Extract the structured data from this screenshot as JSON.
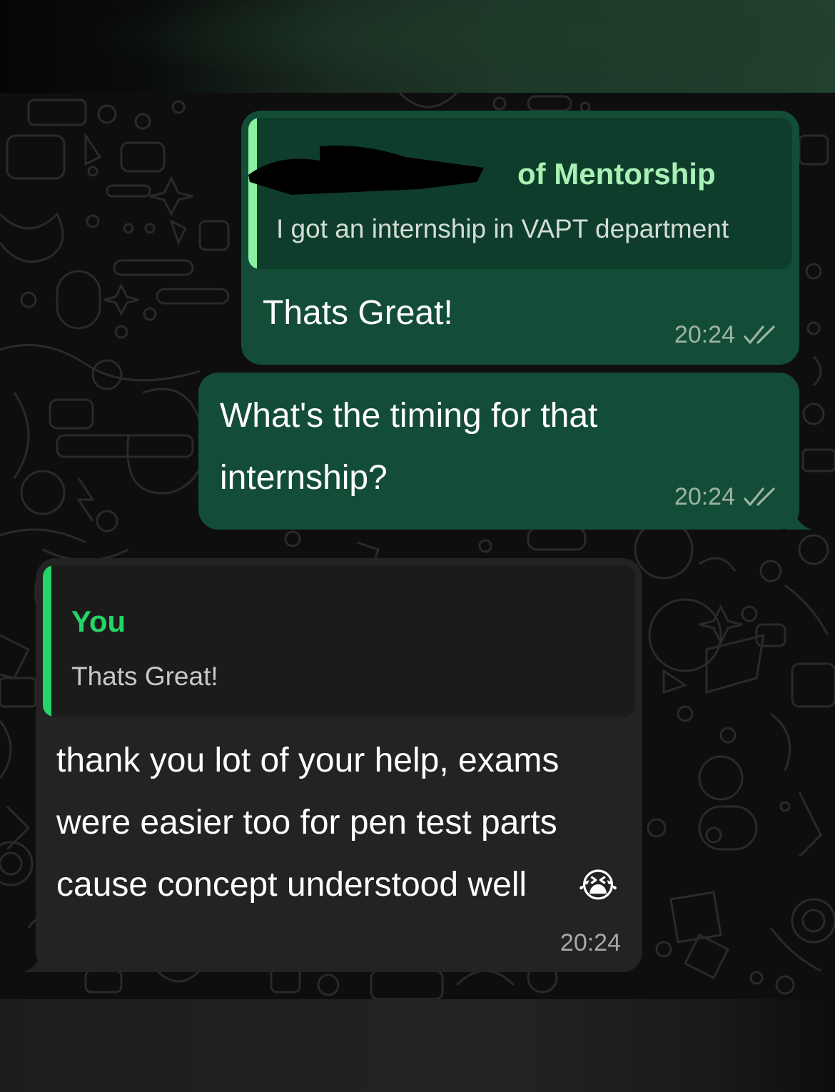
{
  "messages": [
    {
      "direction": "outgoing",
      "reply_to": {
        "name": "of Mentorship",
        "text": "I got an internship in VAPT department"
      },
      "text": "Thats Great!",
      "time": "20:24",
      "status_icon": "double-check-icon"
    },
    {
      "direction": "outgoing",
      "text": "What's the timing for that\ninternship?",
      "time": "20:24",
      "status_icon": "double-check-icon"
    },
    {
      "direction": "incoming",
      "reply_to": {
        "name": "You",
        "text": "Thats Great!"
      },
      "text": "thank you lot of your help, exams\nwere easier too for pen test parts\ncause concept understood well",
      "emoji": "😭",
      "time": "20:24"
    }
  ],
  "colors": {
    "outgoing_bubble": "#144d37",
    "incoming_bubble": "#232323",
    "quote_bar_outgoing": "#8af0a0",
    "quote_bar_incoming": "#25d366",
    "quote_name_incoming": "#25d366",
    "quote_name_outgoing": "#a8f0b4"
  }
}
